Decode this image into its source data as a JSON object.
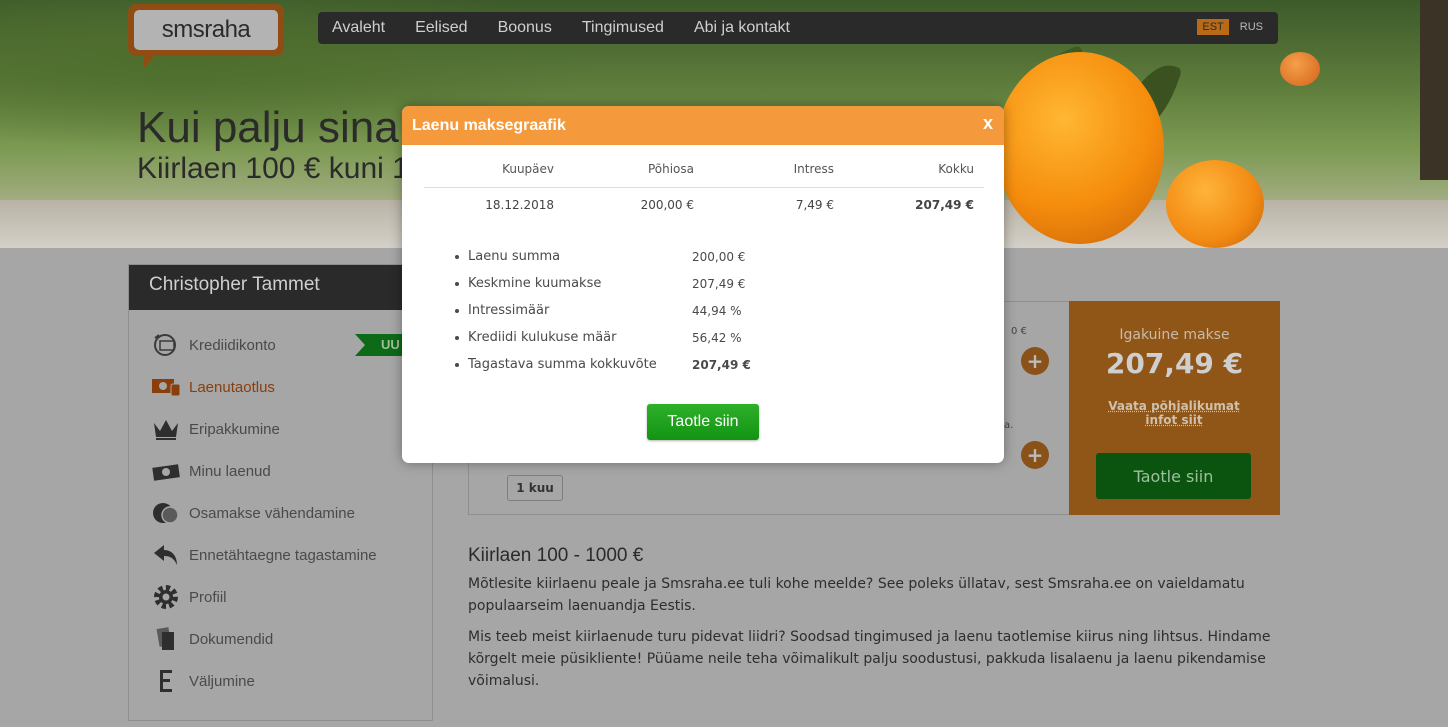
{
  "brand": {
    "logo_text": "smsraha"
  },
  "nav": {
    "items": [
      "Avaleht",
      "Eelised",
      "Boonus",
      "Tingimused",
      "Abi ja kontakt"
    ],
    "lang_active": "EST",
    "lang_other": "RUS"
  },
  "hero": {
    "title": "Kui palju sina",
    "subtitle": "Kiirlaen 100 € kuni 1"
  },
  "sidebar": {
    "user_name": "Christopher Tammet",
    "items": [
      {
        "label": "Krediidikonto",
        "icon": "credit-account-icon"
      },
      {
        "label": "Laenutaotlus",
        "icon": "loan-application-icon"
      },
      {
        "label": "Eripakkumine",
        "icon": "crown-icon"
      },
      {
        "label": "Minu laenud",
        "icon": "money-icon"
      },
      {
        "label": "Osamakse vähendamine",
        "icon": "coins-icon"
      },
      {
        "label": "Ennetähtaegne tagastamine",
        "icon": "undo-arrow-icon"
      },
      {
        "label": "Profiil",
        "icon": "gear-icon"
      },
      {
        "label": "Dokumendid",
        "icon": "documents-icon"
      },
      {
        "label": "Väljumine",
        "icon": "exit-icon"
      }
    ],
    "new_badge": "UU"
  },
  "calculator": {
    "monthly_label": "Igakuine makse",
    "monthly_value": "207,49 €",
    "info_link": "Vaata põhjalikumat infot siit",
    "apply_button": "Taotle siin",
    "period_chip": "1 kuu",
    "partial_amount": "0 €",
    "partial_dot": "a."
  },
  "article": {
    "heading": "Kiirlaen 100 - 1000 €",
    "p1": "Mõtlesite kiirlaenu peale ja Smsraha.ee tuli kohe meelde? See poleks üllatav, sest Smsraha.ee on vaieldamatu populaarseim laenuandja Eestis.",
    "p2": "Mis teeb meist kiirlaenude turu pidevat liidri? Soodsad tingimused ja laenu taotlemise kiirus ning lihtsus. Hindame kõrgelt meie püsikliente! Püüame neile teha võimalikult palju soodustusi, pakkuda lisalaenu ja laenu pikendamise võimalusi."
  },
  "modal": {
    "title": "Laenu maksegraafik",
    "close": "x",
    "columns": [
      "Kuupäev",
      "Põhiosa",
      "Intress",
      "Kokku"
    ],
    "rows": [
      [
        "18.12.2018",
        "200,00 €",
        "7,49 €",
        "207,49 €"
      ]
    ],
    "summary": [
      {
        "label": "Laenu summa",
        "value": "200,00 €"
      },
      {
        "label": "Keskmine kuumakse",
        "value": "207,49 €"
      },
      {
        "label": "Intressimäär",
        "value": "44,94 %"
      },
      {
        "label": "Krediidi kulukuse määr",
        "value": "56,42 %"
      },
      {
        "label": "Tagastava summa kokkuvõte",
        "value": "207,49 €"
      }
    ],
    "apply_button": "Taotle siin"
  }
}
